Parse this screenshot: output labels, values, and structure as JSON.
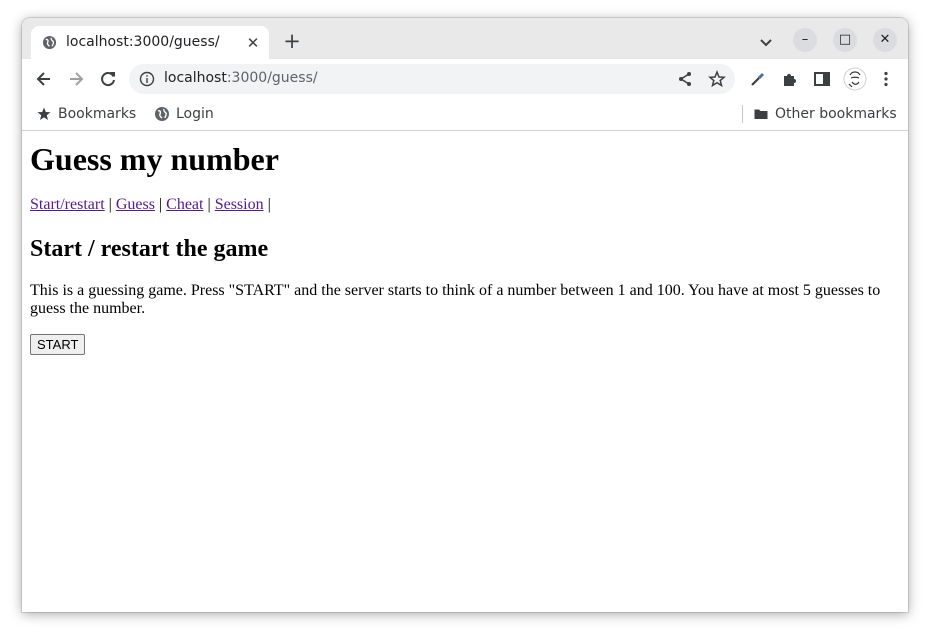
{
  "browser": {
    "tab": {
      "title": "localhost:3000/guess/",
      "favicon": "globe-icon",
      "close": "✕"
    },
    "new_tab": "+",
    "window_controls": {
      "minimize": "–",
      "maximize": "□",
      "close": "✕"
    },
    "address": {
      "host": "localhost",
      "path": ":3000/guess/"
    },
    "bookmarks": {
      "bookmarks_label": "Bookmarks",
      "login_label": "Login",
      "other_label": "Other bookmarks"
    },
    "colors": {
      "tabstrip": "#e9e9ea",
      "omnibox": "#f1f3f4",
      "link_visited": "#551a8b"
    }
  },
  "page": {
    "title": "Guess my number",
    "nav": {
      "start": "Start/restart",
      "guess": "Guess",
      "cheat": "Cheat",
      "session": "Session",
      "separator": " | "
    },
    "section_title": "Start / restart the game",
    "description": "This is a guessing game. Press \"START\" and the server starts to think of a number between 1 and 100. You have at most 5 guesses to guess the number.",
    "start_button": "START"
  }
}
